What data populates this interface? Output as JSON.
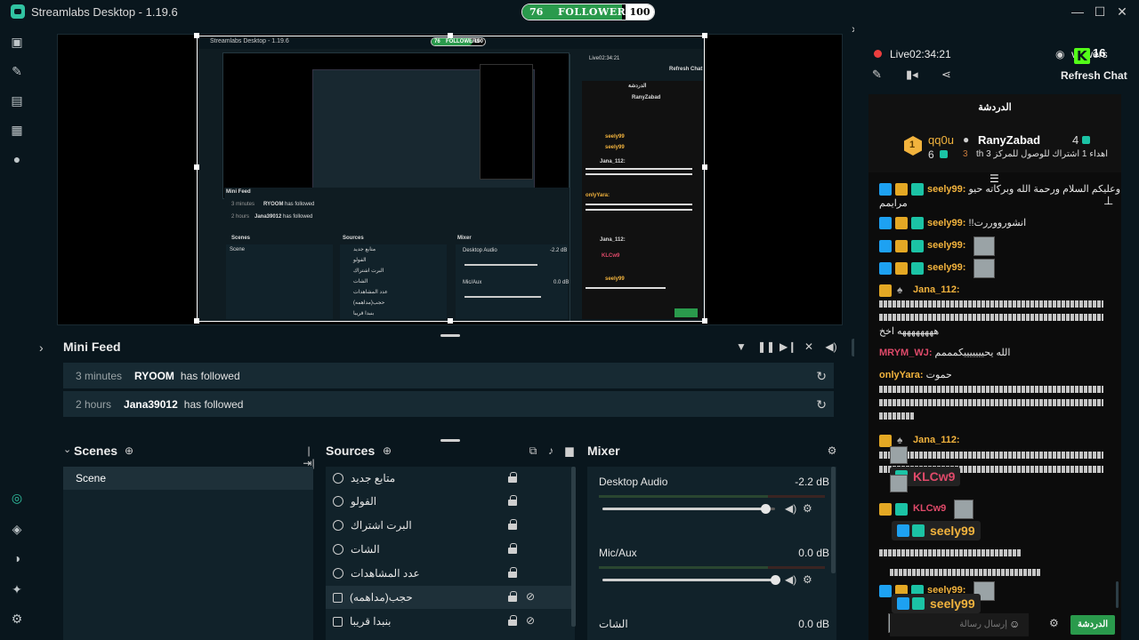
{
  "window": {
    "title": "Streamlabs Desktop - 1.19.6",
    "minimize": "—",
    "maximize": "☐",
    "close": "✕"
  },
  "followers_goal": {
    "current": "76",
    "label": "FOLLOWERS",
    "target": "100",
    "progress_fraction": 0.76,
    "fill_color": "#2a9a4c"
  },
  "sidebar_icons": [
    "studio-icon",
    "themes-icon",
    "store-icon",
    "layout-icon",
    "record-icon",
    "highlighter-icon",
    "integrations-icon",
    "theme-toggle-icon",
    "dual-output-icon",
    "settings-icon"
  ],
  "preview": {
    "inner_title": "Streamlabs Desktop - 1.19.6",
    "inner_goal_cur": "76",
    "inner_goal_label": "FOLLOWERS",
    "inner_goal_max": "100",
    "inner_mini_feed": "Mini Feed",
    "inner_feed1_time": "3 minutes",
    "inner_feed1_user": "RYOOM",
    "inner_feed1_action": "has followed",
    "inner_feed2_time": "2 hours",
    "inner_feed2_user": "Jana39012",
    "inner_feed2_action": "has followed",
    "inner_scenes": "Scenes",
    "inner_scene": "Scene",
    "inner_sources": "Sources",
    "inner_mixer": "Mixer",
    "inner_desktop_audio": "Desktop Audio",
    "inner_desktop_db": "-2.2 dB",
    "inner_mic": "Mic/Aux",
    "inner_mic_db": "0.0 dB",
    "inner_live": "Live02:34:21",
    "inner_refresh": "Refresh Chat",
    "inner_chat_header": "الدردشة",
    "inner_ranyzabad": "RanyZabad",
    "inner_seely": "seely99",
    "inner_jana": "Jana_112:",
    "inner_klcw": "KLCw9",
    "inner_onlyyara": "onlyYara:",
    "inner_src_items": [
      "متابع جديد",
      "الفولو",
      "البرت اشتراك",
      "الشات",
      "عدد المشاهدات",
      "حجب(مداهمه)",
      "بنبدا قريبا"
    ]
  },
  "mini_feed": {
    "title": "Mini Feed",
    "rows": [
      {
        "time": "3 minutes",
        "user": "RYOOM",
        "action": "has followed"
      },
      {
        "time": "2 hours",
        "user": "Jana39012",
        "action": "has followed"
      }
    ]
  },
  "scenes": {
    "title": "Scenes",
    "items": [
      "Scene"
    ]
  },
  "sources": {
    "title": "Sources",
    "items": [
      {
        "name": "متابع جديد",
        "type": "browser"
      },
      {
        "name": "الفولو",
        "type": "browser"
      },
      {
        "name": "البرت اشتراك",
        "type": "browser"
      },
      {
        "name": "الشات",
        "type": "browser"
      },
      {
        "name": "عدد المشاهدات",
        "type": "browser"
      },
      {
        "name": "حجب(مداهمه)",
        "type": "image",
        "hidden": true
      },
      {
        "name": "بنبدا قريبا",
        "type": "image",
        "hidden": true
      }
    ],
    "selected_index": 5
  },
  "mixer": {
    "title": "Mixer",
    "channels": [
      {
        "name": "Desktop Audio",
        "db": "-2.2 dB",
        "volume": 0.94
      },
      {
        "name": "Mic/Aux",
        "db": "0.0 dB",
        "volume": 1.0
      },
      {
        "name": "الشات",
        "db": "0.0 dB",
        "volume": 1.0
      }
    ]
  },
  "chat_panel": {
    "live_label": "Live",
    "live_time": "02:34:21",
    "viewers_label": "viewers",
    "viewer_count": "16",
    "refresh_label": "Refresh Chat",
    "header": "الدردشة",
    "pinned": {
      "user1": "qq0u",
      "user1_count": "6",
      "user2": "RanyZabad",
      "user2_count": "4",
      "rank3": "3",
      "pinned_text": "اهداء 1 اشتراك للوصول للمركز 3 th"
    },
    "messages": [
      {
        "user": "seely99:",
        "text": "وعليكم السلام ورحمة الله وبركاته حيو",
        "color": "#f2b33d"
      },
      {
        "user": "",
        "text": "مرايمم",
        "color": "#e6e6e6"
      },
      {
        "user": "seely99:",
        "text": "!!انشورووررت",
        "color": "#f2b33d"
      },
      {
        "user": "seely99:",
        "text": "",
        "color": "#f2b33d"
      },
      {
        "user": "seely99:",
        "text": "",
        "color": "#f2b33d"
      },
      {
        "user": "Jana_112:",
        "text": "",
        "color": "#f2b33d"
      },
      {
        "user": "",
        "text": "ههههههههه اخخ",
        "color": "#e6e6e6"
      },
      {
        "user": "MRYM_WJ:",
        "text": "الله يحيييييييكمممم",
        "color": "#e04a6a"
      },
      {
        "user": "onlyYara:",
        "text": "حموت",
        "color": "#f2b33d"
      },
      {
        "user": "Jana_112:",
        "text": "",
        "color": "#f2b33d"
      }
    ],
    "overlay_user1": "KLCw9",
    "overlay_user2": "seely99",
    "overlay_user3": "seely99",
    "overlay_klcw_small": "KLCw9",
    "overlay_seely_small": "seely99:",
    "chat_input_placeholder": "إرسال رسالة",
    "send_label": "الدردشة"
  },
  "colors": {
    "background": "#09161d",
    "accent": "#31c3a2",
    "live": "#ec3e3e",
    "kick_green": "#53fc18",
    "panel": "#11222a"
  }
}
